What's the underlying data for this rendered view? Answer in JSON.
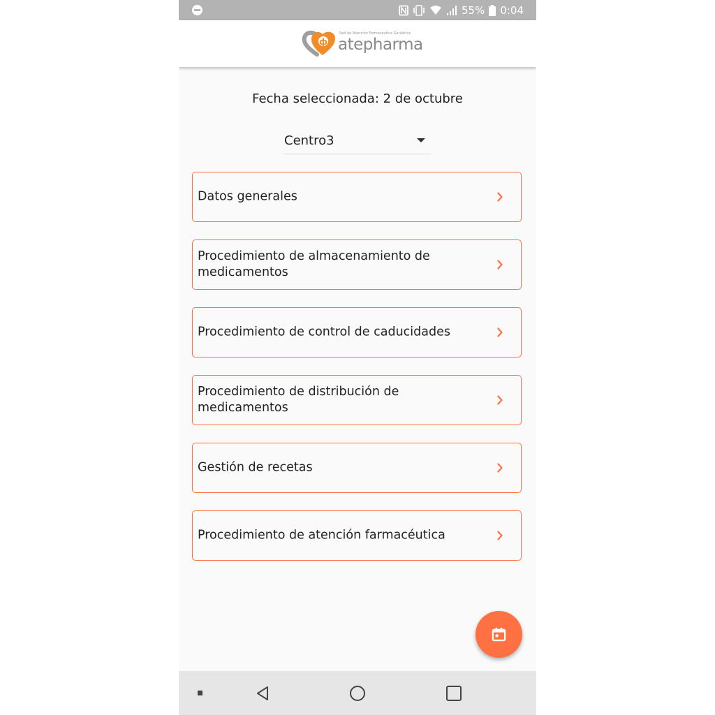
{
  "status_bar": {
    "battery_percent": "55%",
    "time": "0:04",
    "icons": [
      "dnd-icon",
      "nfc-icon",
      "vibrate-icon",
      "wifi-icon",
      "signal-icon",
      "battery-icon"
    ]
  },
  "header": {
    "logo_tagline": "Red de Atención Farmacéutica Geriátrica",
    "logo_text": "atepharma"
  },
  "main": {
    "date_label": "Fecha seleccionada: 2 de octubre",
    "center_select": {
      "selected": "Centro3"
    },
    "menu_items": [
      {
        "label": "Datos generales"
      },
      {
        "label": "Procedimiento de almacenamiento de medicamentos"
      },
      {
        "label": "Procedimiento de control de caducidades"
      },
      {
        "label": "Procedimiento de distribución de medicamentos"
      },
      {
        "label": "Gestión de recetas"
      },
      {
        "label": "Procedimiento de atención farmacéutica"
      }
    ]
  },
  "fab": {
    "icon": "calendar-icon"
  },
  "nav_bar": {
    "icons": [
      "menu-dot-icon",
      "back-icon",
      "home-icon",
      "recents-icon"
    ]
  },
  "colors": {
    "accent": "#ff7043",
    "status_bar": "#b3b3b3",
    "background": "#fafafa",
    "nav_bar": "#e6e6e6"
  }
}
